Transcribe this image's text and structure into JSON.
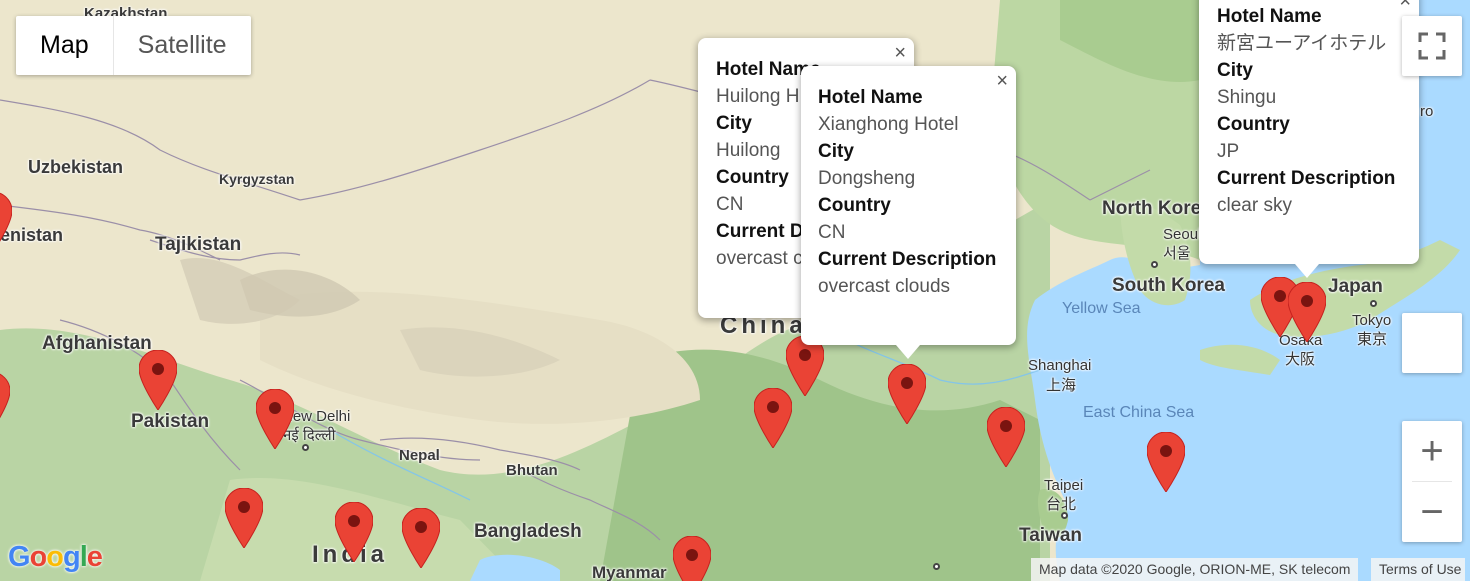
{
  "map": {
    "type_controls": {
      "map_label": "Map",
      "satellite_label": "Satellite",
      "selected": "Map"
    },
    "labels": {
      "kazakhstan": "Kazakhstan",
      "uzbekistan": "Uzbekistan",
      "kyrgyzstan": "Kyrgyzstan",
      "tajikistan": "Tajikistan",
      "turkmenistan": "enistan",
      "afghanistan": "Afghanistan",
      "pakistan": "Pakistan",
      "new_delhi": "New Delhi",
      "new_delhi_hi": "नई दिल्ली",
      "nepal": "Nepal",
      "bhutan": "Bhutan",
      "india": "India",
      "bangladesh": "Bangladesh",
      "myanmar": "Myanmar",
      "china": "China",
      "north_korea": "North Korea",
      "seoul": "Seoul",
      "seoul_ko": "서울",
      "south_korea": "South Korea",
      "yellow_sea": "Yellow Sea",
      "japan": "Japan",
      "tokyo": "Tokyo",
      "tokyo_ja": "東京",
      "osaka": "Osaka",
      "osaka_ja": "大阪",
      "shanghai": "Shanghai",
      "shanghai_zh": "上海",
      "east_china_sea": "East China Sea",
      "taipei": "Taipei",
      "taipei_zh": "台北",
      "taiwan": "Taiwan",
      "edge_ro": "ro"
    },
    "marker_color": "#ea4335",
    "marker_count": 15,
    "info_windows": [
      {
        "hotel_name_label": "Hotel Name",
        "hotel_name": "Huilong H",
        "city_label": "City",
        "city": "Huilong",
        "country_label": "Country",
        "country": "CN",
        "desc_label": "Current D",
        "desc": "overcast c"
      },
      {
        "hotel_name_label": "Hotel Name",
        "hotel_name": "Xianghong Hotel",
        "city_label": "City",
        "city": "Dongsheng",
        "country_label": "Country",
        "country": "CN",
        "desc_label": "Current Description",
        "desc": "overcast clouds"
      },
      {
        "hotel_name_label": "Hotel Name",
        "hotel_name": "新宮ユーアイホテル",
        "city_label": "City",
        "city": "Shingu",
        "country_label": "Country",
        "country": "JP",
        "desc_label": "Current Description",
        "desc": "clear sky"
      }
    ],
    "close_glyph": "×",
    "zoom_in": "+",
    "zoom_out": "−",
    "google_logo": "Google",
    "attribution": "Map data ©2020 Google, ORION-ME, SK telecom",
    "terms": "Terms of Use"
  }
}
